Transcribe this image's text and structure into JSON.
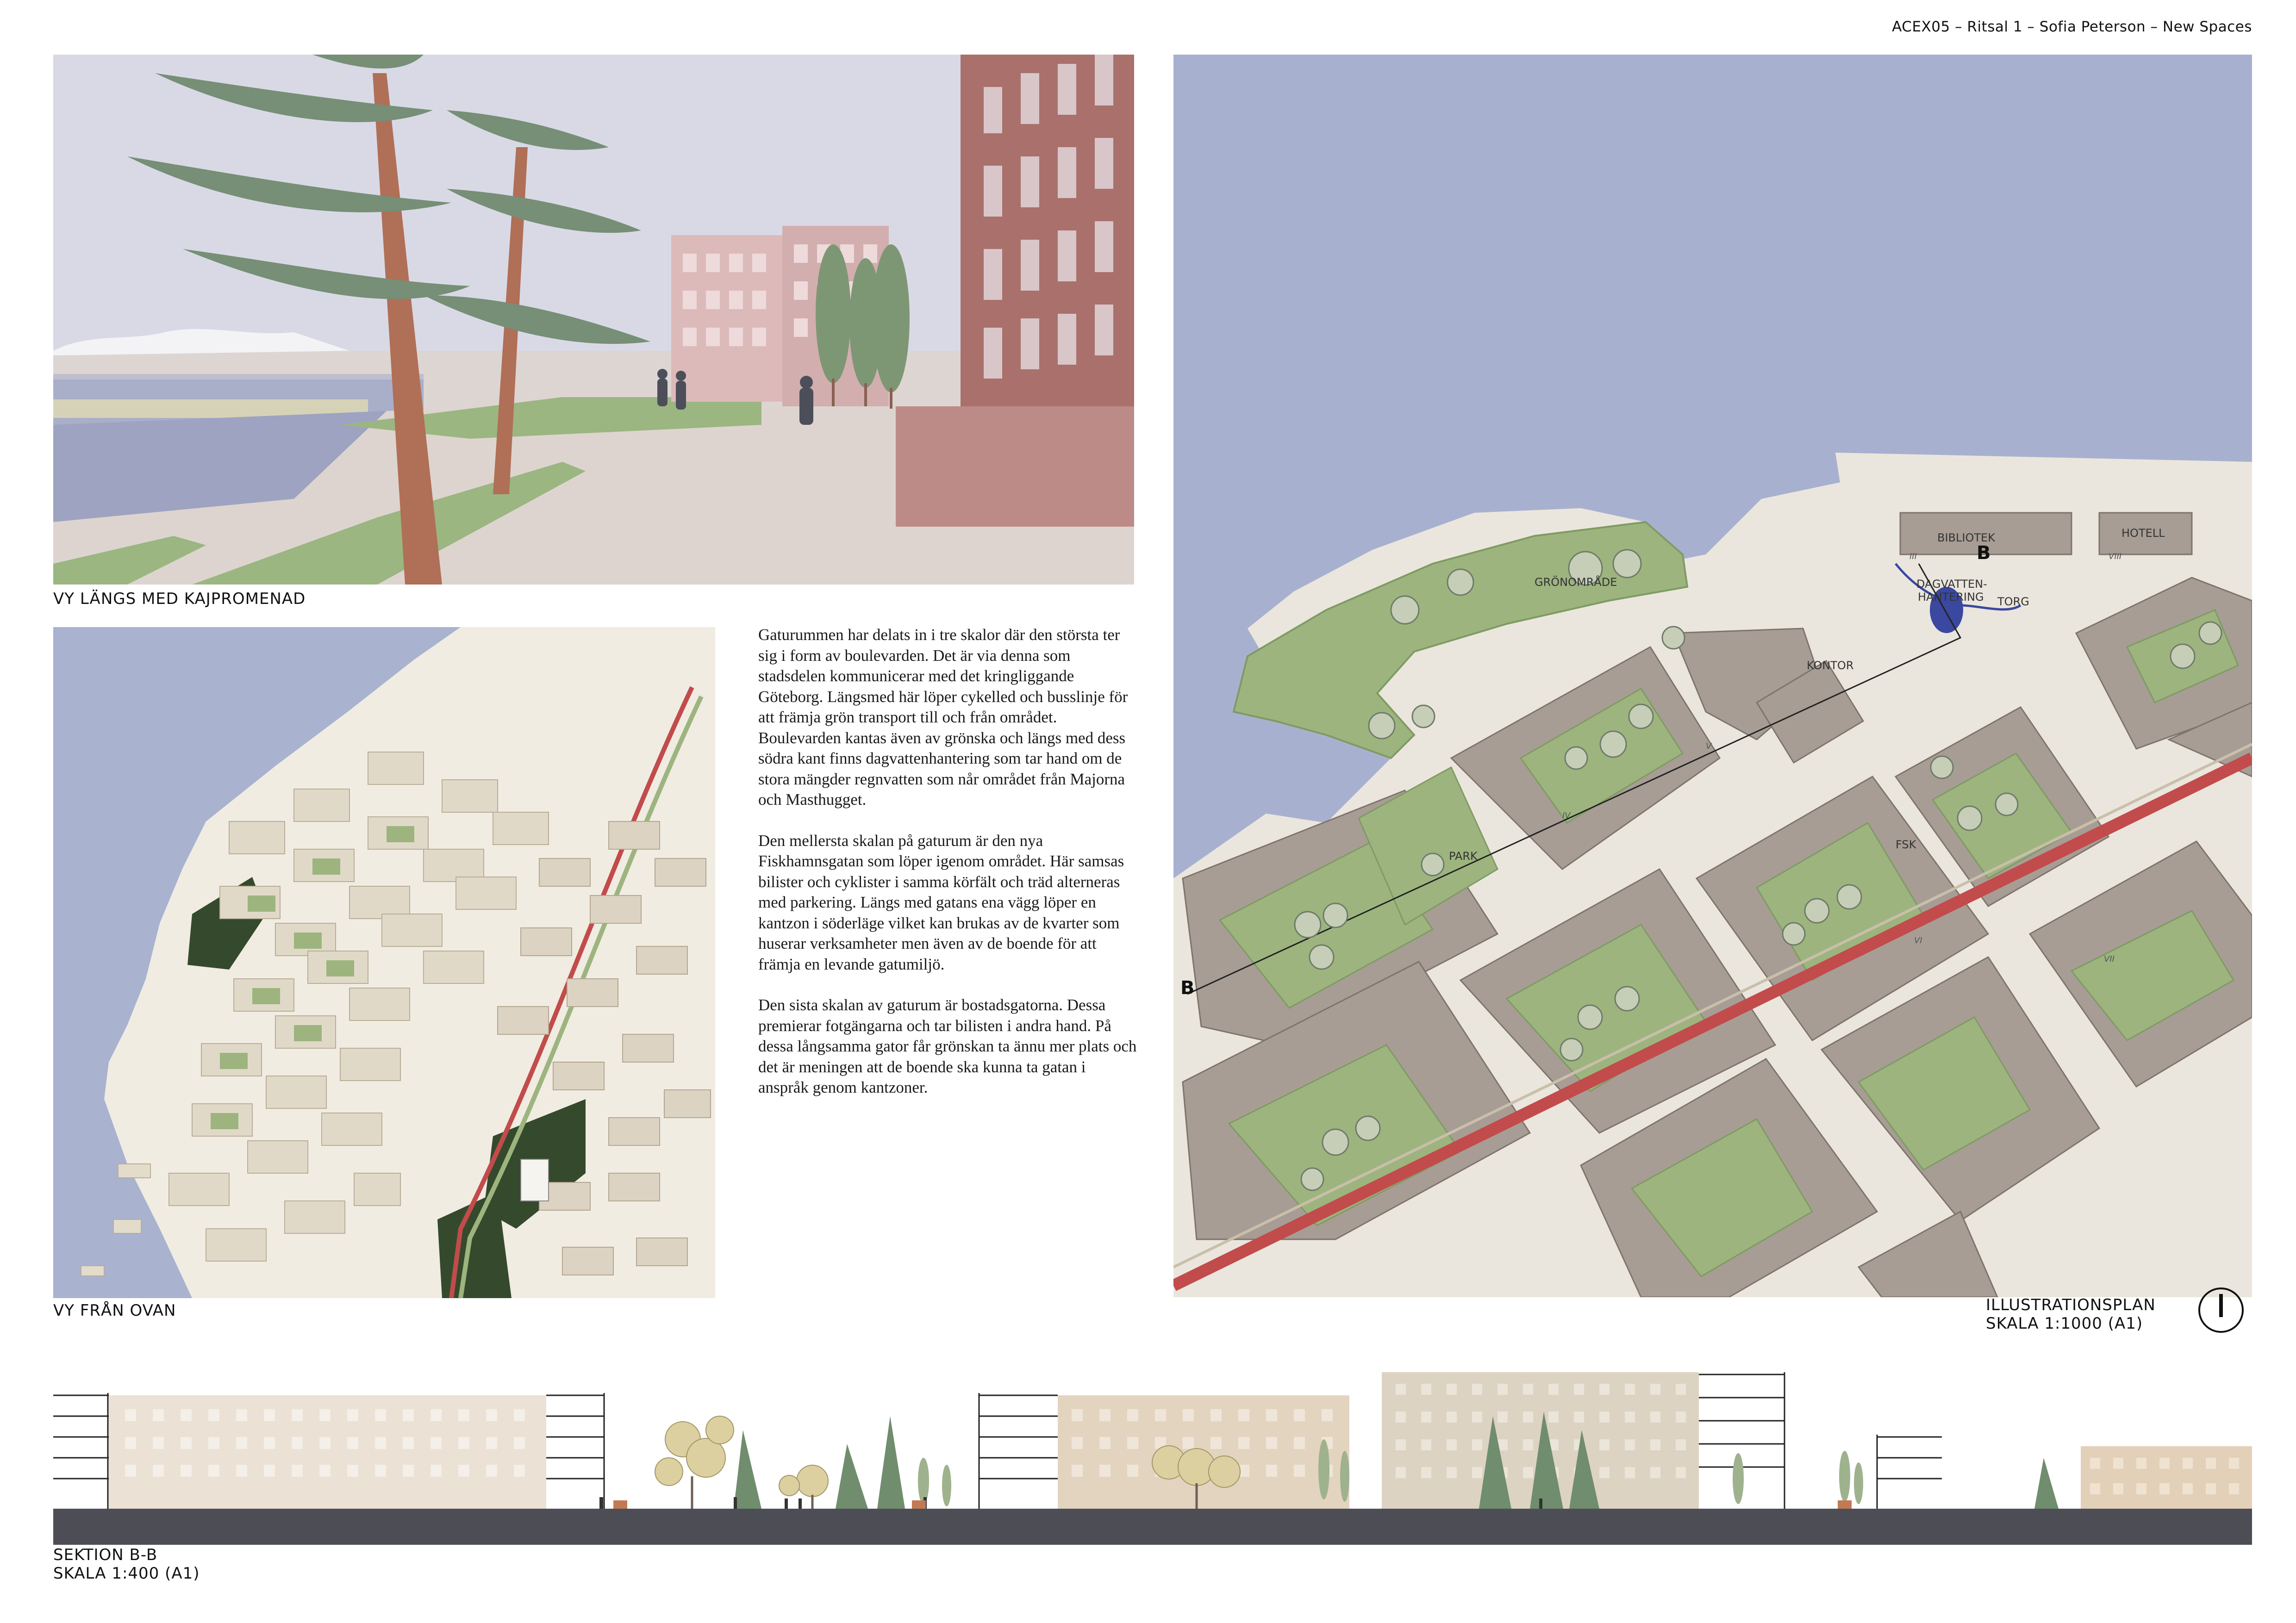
{
  "header": {
    "title": "ACEX05 – Ritsal 1 – Sofia Peterson – New Spaces"
  },
  "captions": {
    "view_promenade": "VY LÄNGS MED KAJPROMENAD",
    "view_above": "VY FRÅN OVAN",
    "plan_title": "ILLUSTRATIONSPLAN",
    "plan_scale": "SKALA 1:1000 (A1)",
    "section_title": "SEKTION B-B",
    "section_scale": "SKALA 1:400 (A1)"
  },
  "text": {
    "p1": "Gaturummen har delats in i tre skalor där den största ter sig i form av boulevarden. Det är via denna som stadsdelen kommunicerar med det kringliggande Göteborg. Längsmed här löper cykelled och busslinje för att främja grön transport till och från området. Boulevarden kantas även av grönska och längs med dess södra kant finns dagvattenhantering som tar hand om de stora mängder regnvatten som når området från Majorna och Masthugget.",
    "p2": "Den mellersta skalan på gaturum är den nya Fiskhamnsgatan som löper igenom området. Här samsas bilister och cyklister i samma körfält och träd alterneras med parkering. Längs med gatans ena vägg löper en kantzon i söderläge vilket kan brukas av de kvarter som huserar verksamheter men även av de boende för att främja en levande gatumiljö.",
    "p3": "Den sista skalan av gaturum är bostadsgatorna. Dessa premierar fotgängarna och tar bilisten i andra hand. På dessa långsamma gator får grönskan ta ännu mer plats och det är meningen att de boende ska kunna ta gatan i anspråk genom kantzoner."
  },
  "plan_labels": {
    "bibliotek": "BIBLIOTEK",
    "hotell": "HOTELL",
    "dagvatten_1": "DAGVATTEN-",
    "dagvatten_2": "HANTERING",
    "torg": "TORG",
    "gronomrade": "GRÖNOMRÅDE",
    "kontor": "KONTOR",
    "fsk": "FSK",
    "park": "PARK",
    "section_mark": "B",
    "north": "I",
    "floors": [
      "III",
      "VIII",
      "IV",
      "V",
      "VI",
      "VII"
    ]
  },
  "colors": {
    "water": "#a7b1cf",
    "green": "#9db47f",
    "building": "#a79d95",
    "paving": "#e7e1d8",
    "boulevard_red": "#c24b4b",
    "brick": "#b88a86",
    "tree": "#708d6e",
    "ground_dark": "#4d4e55"
  }
}
